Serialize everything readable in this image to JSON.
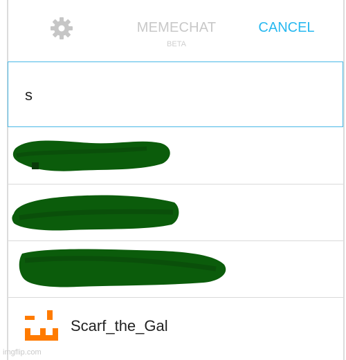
{
  "header": {
    "title": "MEMECHAT",
    "subtitle": "BETA",
    "cancel_label": "CANCEL",
    "settings_icon": "gear-icon"
  },
  "search": {
    "value": "s",
    "placeholder": ""
  },
  "results": [
    {
      "redacted": true
    },
    {
      "redacted": true
    },
    {
      "redacted": true
    },
    {
      "username": "Scarf_the_Gal",
      "avatar_icon": "orange-pixel-face-avatar"
    }
  ],
  "colors": {
    "accent": "#27b8f0",
    "search_border": "#48b8e6",
    "redaction": "#0b5c0b",
    "avatar": "#ff7b00",
    "title_gray": "#c8c8c8"
  },
  "watermark": "imgflip.com"
}
